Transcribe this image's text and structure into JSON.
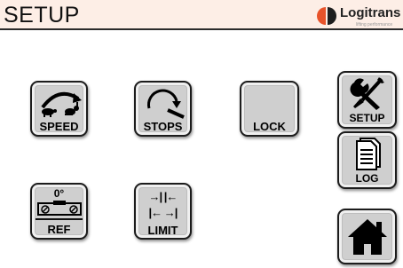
{
  "header": {
    "title": "SETUP",
    "brand_name": "Logitrans",
    "brand_tagline": "lifting performance",
    "logo_colors": [
      "#e8532a",
      "#1e1e1e"
    ]
  },
  "buttons": {
    "speed": {
      "label": "SPEED",
      "icon": "speed-tortoise-hare-icon"
    },
    "stops": {
      "label": "STOPS",
      "icon": "stops-arc-arrow-icon"
    },
    "lock": {
      "label": "LOCK"
    },
    "ref": {
      "label": "REF",
      "angle": "0°",
      "icon": "level-icon"
    },
    "limit": {
      "label": "LIMIT",
      "icon": "limit-arrows-icon",
      "arrows_top": "→| |←",
      "arrows_bottom": "|← →|"
    },
    "setup": {
      "label": "SETUP",
      "icon": "wrench-screwdriver-icon"
    },
    "log": {
      "label": "LOG",
      "icon": "document-icon"
    },
    "home": {
      "icon": "home-icon"
    }
  },
  "colors": {
    "header_bg": "#fdeee6",
    "button_face": "#cfcfcf",
    "border": "#1c1c1c"
  }
}
